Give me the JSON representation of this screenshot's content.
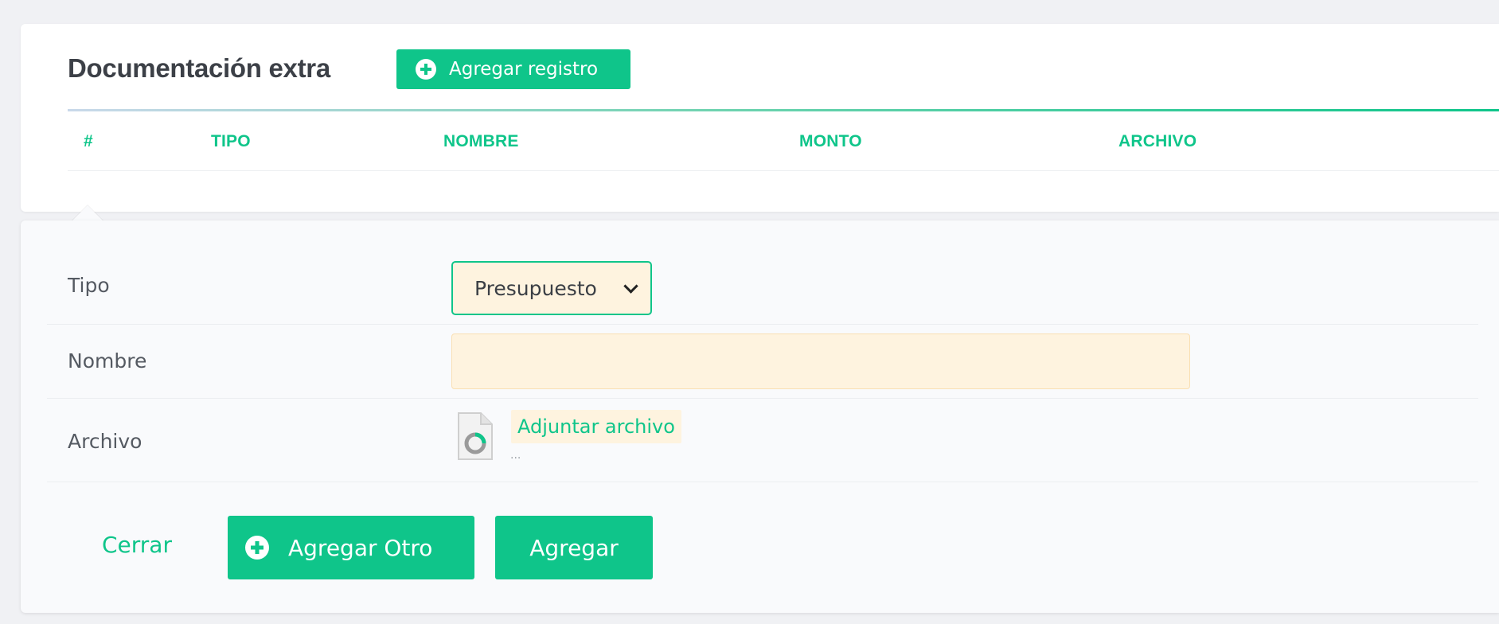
{
  "section": {
    "title": "Documentación extra",
    "add_record_label": "Agregar registro"
  },
  "table": {
    "columns": [
      "#",
      "TIPO",
      "NOMBRE",
      "MONTO",
      "ARCHIVO"
    ]
  },
  "form": {
    "tipo_label": "Tipo",
    "tipo_value": "Presupuesto",
    "nombre_label": "Nombre",
    "nombre_value": "",
    "archivo_label": "Archivo",
    "attach_label": "Adjuntar archivo",
    "attach_sub": "..."
  },
  "actions": {
    "close_label": "Cerrar",
    "add_other_label": "Agregar Otro",
    "add_label": "Agregar"
  },
  "colors": {
    "accent": "#0fc58a",
    "input_bg": "#fef3df",
    "page_bg": "#f0f1f4"
  }
}
